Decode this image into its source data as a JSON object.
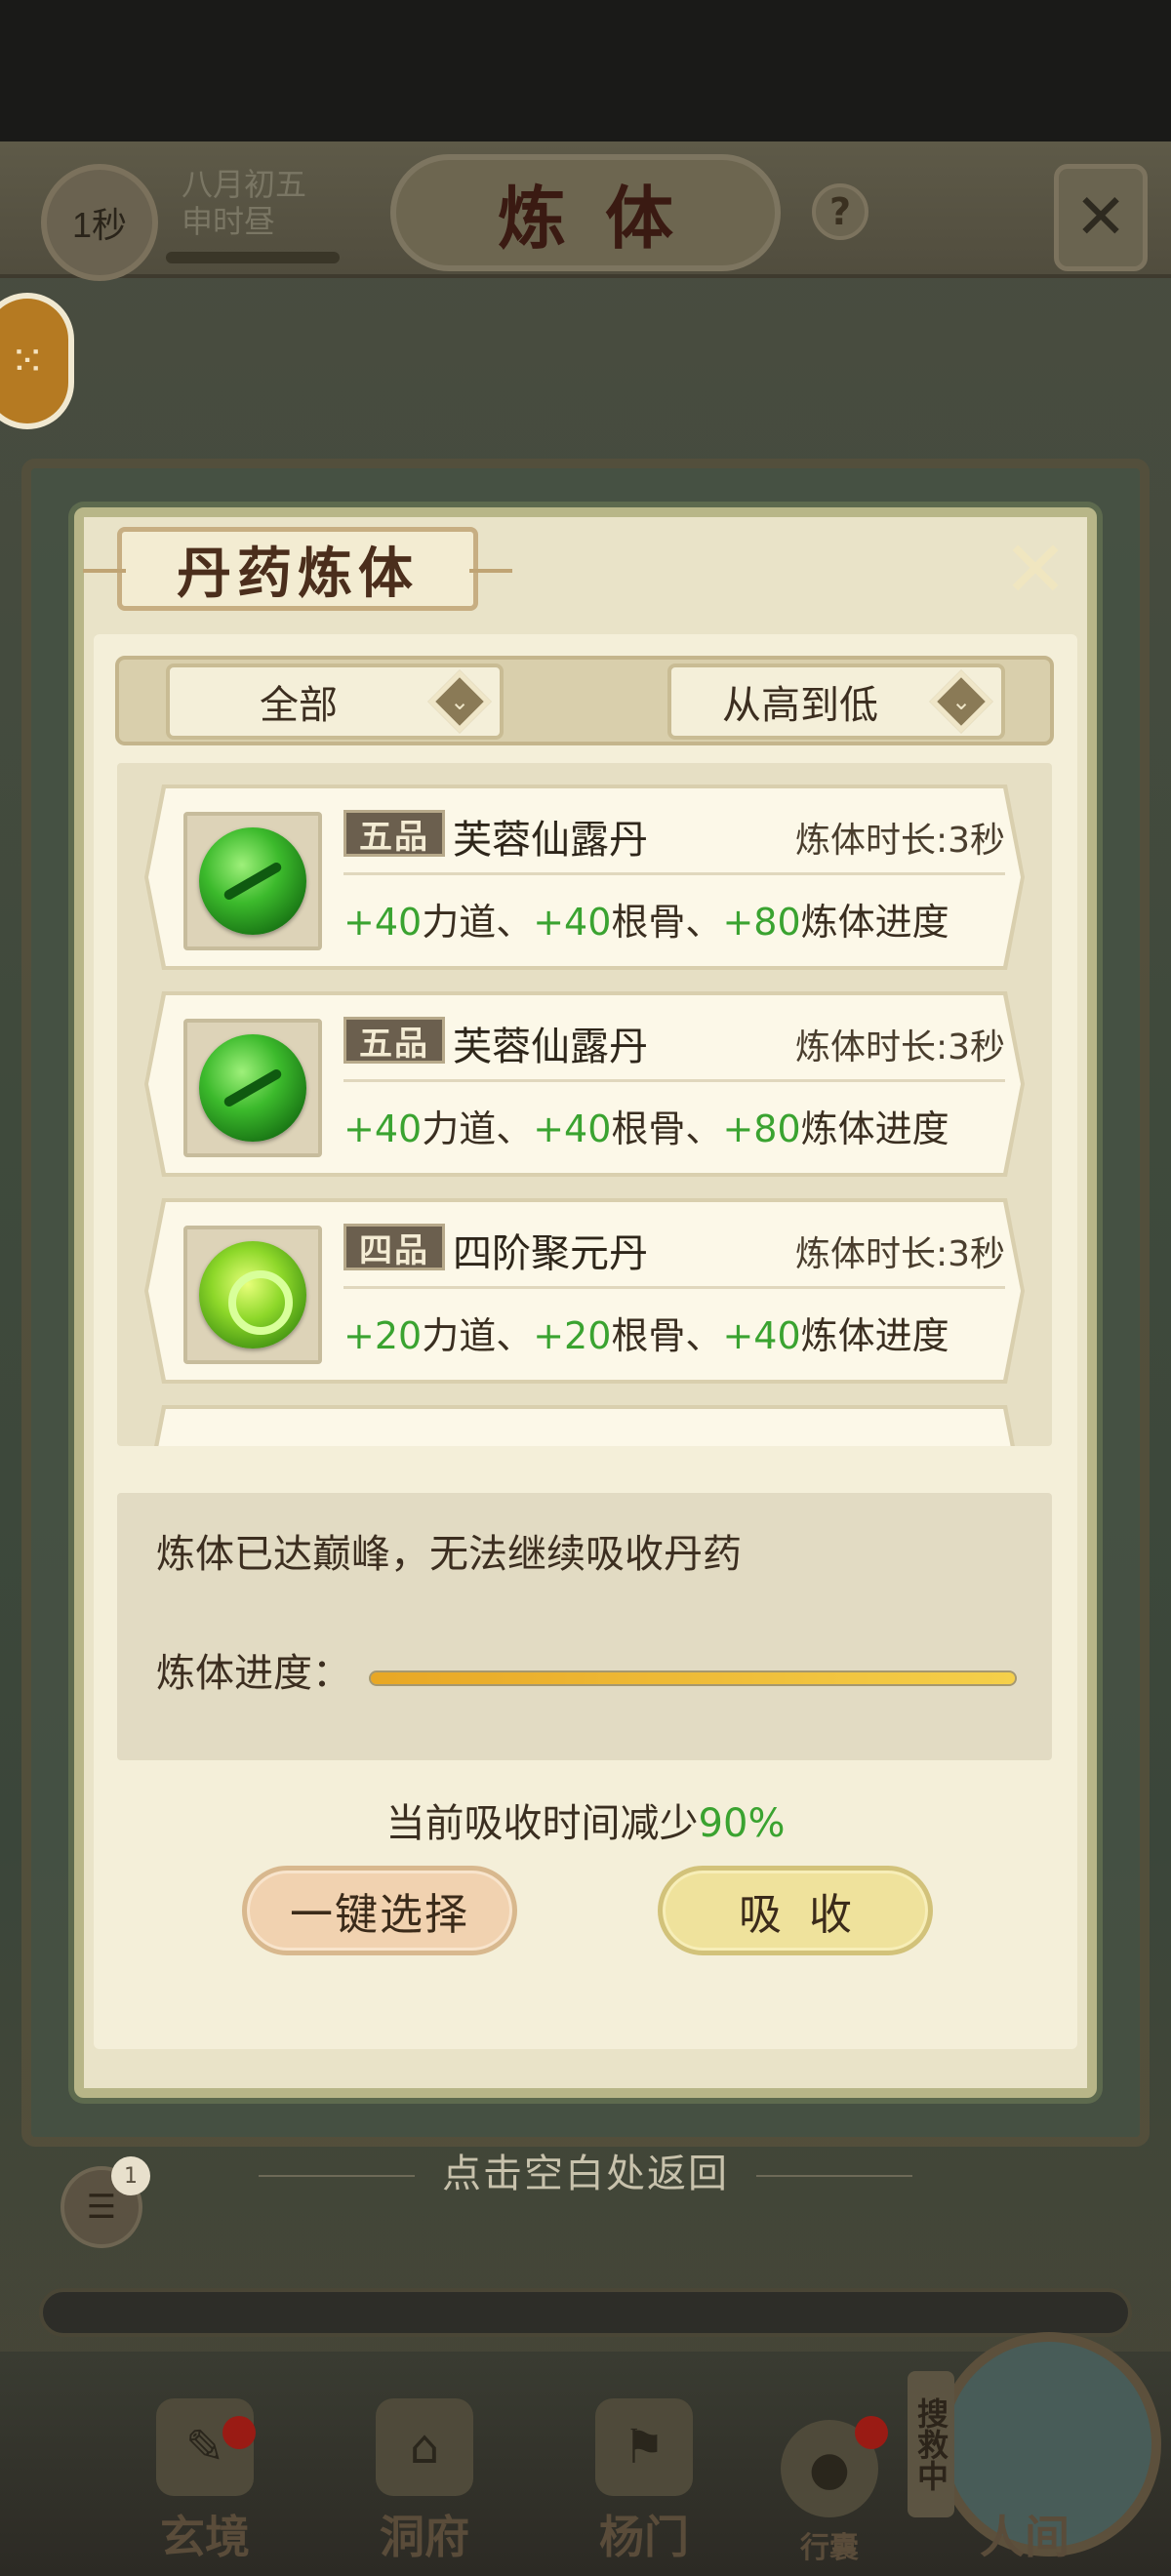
{
  "header": {
    "timer": "1秒",
    "date_line1": "八月初五",
    "date_line2": "申时昼",
    "title": "炼体",
    "help": "?"
  },
  "dialog": {
    "title": "丹药炼体",
    "filter_type": "全部",
    "filter_sort": "从高到低",
    "items": [
      {
        "grade": "五品",
        "name": "芙蓉仙露丹",
        "duration": "炼体时长:3秒",
        "effects": [
          {
            "val": "+40",
            "attr": "力道、"
          },
          {
            "val": "+40",
            "attr": "根骨、"
          },
          {
            "val": "+80",
            "attr": "炼体进度"
          }
        ],
        "icon": "green-orb-pill-icon"
      },
      {
        "grade": "五品",
        "name": "芙蓉仙露丹",
        "duration": "炼体时长:3秒",
        "effects": [
          {
            "val": "+40",
            "attr": "力道、"
          },
          {
            "val": "+40",
            "attr": "根骨、"
          },
          {
            "val": "+80",
            "attr": "炼体进度"
          }
        ],
        "icon": "green-orb-pill-icon"
      },
      {
        "grade": "四品",
        "name": "四阶聚元丹",
        "duration": "炼体时长:3秒",
        "effects": [
          {
            "val": "+20",
            "attr": "力道、"
          },
          {
            "val": "+20",
            "attr": "根骨、"
          },
          {
            "val": "+40",
            "attr": "炼体进度"
          }
        ],
        "icon": "swirl-pill-icon"
      }
    ],
    "status_message": "炼体已达巅峰，无法继续吸收丹药",
    "progress_label": "炼体进度：",
    "progress_value": 1.0,
    "reduce_prefix": "当前吸收时间减少",
    "reduce_value": "90%",
    "btn_select": "一键选择",
    "btn_absorb": "吸收"
  },
  "tap_return": "点击空白处返回",
  "chat_badge": "1",
  "nav": {
    "items": [
      "玄境",
      "洞府",
      "杨门",
      "行囊",
      "人间"
    ],
    "search_tag": "搜救中"
  },
  "colors": {
    "accent_green": "#3aa330",
    "progress_gold": "#f5c234",
    "dialog_bg": "#f4efd9"
  }
}
